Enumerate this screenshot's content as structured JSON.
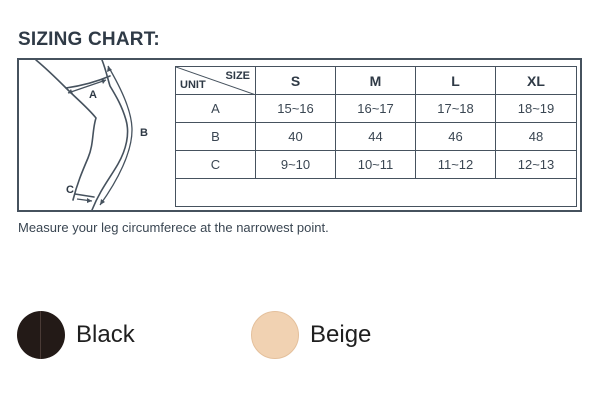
{
  "title": "SIZING CHART:",
  "diagram": {
    "label_a": "A",
    "label_b": "B",
    "label_c": "C"
  },
  "table": {
    "corner_size": "SIZE",
    "corner_unit": "UNIT",
    "columns": [
      "S",
      "M",
      "L",
      "XL"
    ],
    "rows": [
      {
        "label": "A",
        "values": [
          "15~16",
          "16~17",
          "17~18",
          "18~19"
        ]
      },
      {
        "label": "B",
        "values": [
          "40",
          "44",
          "46",
          "48"
        ]
      },
      {
        "label": "C",
        "values": [
          "9~10",
          "10~11",
          "11~12",
          "12~13"
        ]
      }
    ]
  },
  "note": "Measure your leg circumferece at the narrowest point.",
  "colors": [
    {
      "label": "Black",
      "hex": "#231a17"
    },
    {
      "label": "Beige",
      "hex": "#f1d2b2"
    }
  ]
}
